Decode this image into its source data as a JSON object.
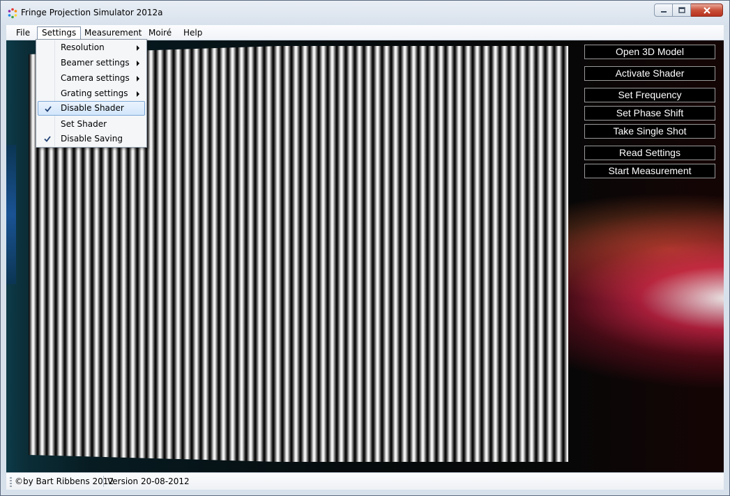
{
  "window": {
    "title": "Fringe Projection Simulator 2012a"
  },
  "menubar": {
    "items": [
      "File",
      "Settings",
      "Measurement",
      "Moiré",
      "Help"
    ]
  },
  "settings_menu": {
    "items": [
      {
        "label": "Resolution",
        "submenu": true,
        "checked": false
      },
      {
        "label": "Beamer settings",
        "submenu": true,
        "checked": false
      },
      {
        "label": "Camera settings",
        "submenu": true,
        "checked": false
      },
      {
        "label": "Grating settings",
        "submenu": true,
        "checked": false
      },
      {
        "label": "Disable Shader",
        "submenu": false,
        "checked": true,
        "highlighted": true
      },
      {
        "label": "Set Shader",
        "submenu": false,
        "checked": false
      },
      {
        "label": "Disable Saving",
        "submenu": false,
        "checked": true
      }
    ]
  },
  "side_buttons": {
    "open_model": "Open 3D Model",
    "activate_shader": "Activate Shader",
    "set_frequency": "Set Frequency",
    "set_phase_shift": "Set Phase Shift",
    "single_shot": "Take Single Shot",
    "read_settings": "Read Settings",
    "start_measurement": "Start Measurement"
  },
  "statusbar": {
    "copyright": "©by Bart Ribbens 2012",
    "version": "Version 20-08-2012"
  },
  "colors": {
    "menu_highlight": "#d2e6fb",
    "close_button": "#c9513a",
    "button_bg": "#000000"
  }
}
